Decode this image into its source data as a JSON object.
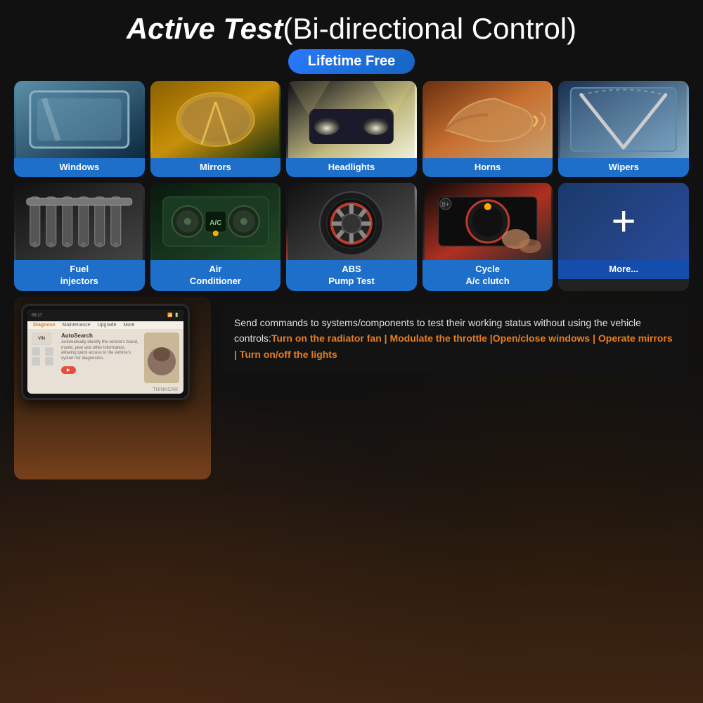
{
  "page": {
    "title_bold": "Active Test",
    "title_normal": "(Bi-directional Control)",
    "lifetime_badge": "Lifetime Free"
  },
  "row1_features": [
    {
      "id": "windows",
      "label": "Windows"
    },
    {
      "id": "mirrors",
      "label": "Mirrors"
    },
    {
      "id": "headlights",
      "label": "Headlights"
    },
    {
      "id": "horns",
      "label": "Horns"
    },
    {
      "id": "wipers",
      "label": "Wipers"
    }
  ],
  "row2_features": [
    {
      "id": "fuel",
      "label": "Fuel\ninjectors"
    },
    {
      "id": "air",
      "label": "Air\nConditioner"
    },
    {
      "id": "abs",
      "label": "ABS\nPump Test"
    },
    {
      "id": "cycle",
      "label": "Cycle\nA/c clutch"
    },
    {
      "id": "more",
      "label": "More..."
    }
  ],
  "tablet": {
    "brand": "THINKCAR",
    "nav_items": [
      "Diagnose",
      "Maintenance",
      "Upgrade",
      "More"
    ],
    "vin_label": "VIN",
    "auto_search": "AutoSearch",
    "auto_search_desc": "Automatically identify the vehicle's brand, model, year and other information, allowing quick access to the vehicle's system for diagnostics."
  },
  "info_box": {
    "normal": "Send commands to systems/components to test their working status without using the vehicle controls:",
    "orange": "Turn on the radiator fan | Modulate the throttle |Open/close windows | Operate mirrors | Turn on/off the lights"
  },
  "more_card": {
    "plus": "+",
    "label": "More..."
  }
}
